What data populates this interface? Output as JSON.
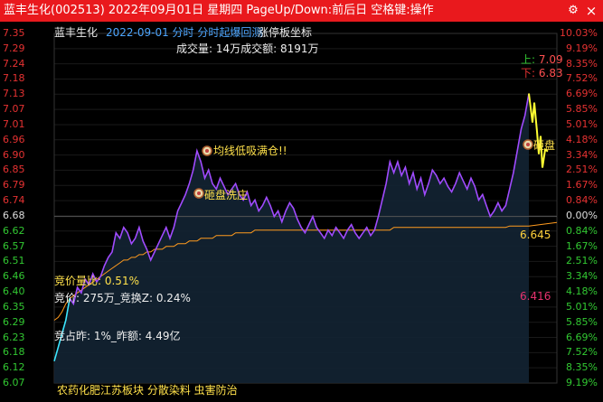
{
  "titlebar": {
    "title": "蓝丰生化(002513) 2022年09月01日 星期四 PageUp/Down:前后日 空格键:操作",
    "settings_icon": "gear-icon",
    "settings_glyph": "⚙",
    "close_icon": "close-icon",
    "close_glyph": "×"
  },
  "header": {
    "stock_name": "蓝丰生化",
    "info": "2022-09-01 分时 分时起爆回测",
    "mode": "涨停板坐标",
    "volume": "成交量: 14万成交额: 8191万"
  },
  "price_axis": [
    "7.35",
    "7.29",
    "7.24",
    "7.18",
    "7.13",
    "7.07",
    "7.01",
    "6.96",
    "6.90",
    "6.85",
    "6.79",
    "6.74",
    "6.68",
    "6.62",
    "6.57",
    "6.51",
    "6.46",
    "6.40",
    "6.35",
    "6.29",
    "6.23",
    "6.18",
    "6.12",
    "6.07"
  ],
  "pct_axis": [
    "10.03%",
    "9.19%",
    "8.35%",
    "7.52%",
    "6.69%",
    "5.85%",
    "5.01%",
    "4.18%",
    "3.34%",
    "2.51%",
    "1.67%",
    "0.84%",
    "0.00%",
    "0.84%",
    "1.67%",
    "2.51%",
    "3.34%",
    "4.18%",
    "5.01%",
    "5.85%",
    "6.69%",
    "7.52%",
    "8.35%",
    "9.19%"
  ],
  "markers": {
    "up_label": "上:",
    "up_value": "7.09",
    "down_label": "下:",
    "down_value": "6.83",
    "avg_price": "6.645",
    "low_price": "6.416"
  },
  "signals": {
    "s1": "均线低吸满仓!!",
    "s2": "砸盘洗庄",
    "s3": "砸盘"
  },
  "info_left": {
    "auction_ratio": "竞价量比: 0.51%",
    "auction_amount": "竞价: 275万_竞换Z: 0.24%",
    "auction_share": "竞占昨: 1%_昨额: 4.49亿"
  },
  "footer": {
    "sectors": "农药化肥江苏板块 分散染料 虫害防治"
  },
  "colors": {
    "titlebar": "#e9191d",
    "price_line": "#a04bff",
    "avg_line": "#ff9b1e",
    "open_line": "#3ce6ff",
    "end_line": "#ffff32",
    "up": "#e63232",
    "down": "#32c832"
  },
  "chart_data": {
    "type": "line",
    "ylim": [
      6.07,
      7.35
    ],
    "prev_close": 6.68,
    "series": [
      {
        "values": [
          6.15,
          6.2,
          6.25,
          6.3,
          6.38,
          6.36,
          6.42,
          6.4,
          6.45,
          6.43,
          6.47,
          6.44,
          6.46,
          6.5,
          6.53,
          6.55,
          6.62,
          6.6,
          6.64,
          6.62,
          6.58,
          6.6,
          6.64,
          6.59,
          6.56,
          6.52,
          6.55,
          6.58,
          6.61,
          6.64,
          6.6,
          6.64,
          6.7,
          6.73,
          6.76,
          6.8,
          6.85,
          6.92,
          6.88,
          6.82,
          6.85,
          6.8,
          6.78,
          6.82,
          6.79,
          6.76,
          6.78,
          6.8,
          6.76,
          6.74,
          6.77,
          6.72,
          6.74,
          6.7,
          6.72,
          6.75,
          6.72,
          6.68,
          6.7,
          6.66,
          6.7,
          6.73,
          6.71,
          6.67,
          6.64,
          6.62,
          6.65,
          6.68,
          6.64,
          6.62,
          6.6,
          6.63,
          6.61,
          6.64,
          6.62,
          6.6,
          6.63,
          6.65,
          6.62,
          6.6,
          6.62,
          6.64,
          6.61,
          6.63,
          6.68,
          6.74,
          6.8,
          6.88,
          6.84,
          6.88,
          6.83,
          6.86,
          6.8,
          6.84,
          6.78,
          6.82,
          6.76,
          6.8,
          6.85,
          6.83,
          6.8,
          6.82,
          6.79,
          6.77,
          6.8,
          6.84,
          6.81,
          6.78,
          6.82,
          6.79,
          6.74,
          6.76,
          6.72,
          6.68,
          6.7,
          6.73,
          6.7,
          6.72,
          6.78,
          6.84,
          6.92,
          7.0,
          7.05,
          7.13
        ]
      },
      {
        "values": [
          6.3,
          6.31,
          6.33,
          6.36,
          6.38,
          6.39,
          6.4,
          6.41,
          6.42,
          6.43,
          6.44,
          6.45,
          6.46,
          6.47,
          6.48,
          6.49,
          6.5,
          6.51,
          6.52,
          6.52,
          6.53,
          6.53,
          6.54,
          6.54,
          6.55,
          6.55,
          6.56,
          6.56,
          6.56,
          6.57,
          6.57,
          6.57,
          6.58,
          6.58,
          6.58,
          6.59,
          6.59,
          6.59,
          6.6,
          6.6,
          6.6,
          6.6,
          6.61,
          6.61,
          6.61,
          6.61,
          6.61,
          6.62,
          6.62,
          6.62,
          6.62,
          6.62,
          6.63,
          6.63,
          6.63,
          6.63,
          6.63,
          6.63,
          6.63,
          6.63,
          6.63,
          6.63,
          6.63,
          6.63,
          6.63,
          6.63,
          6.63,
          6.63,
          6.63,
          6.63,
          6.63,
          6.63,
          6.63,
          6.63,
          6.63,
          6.63,
          6.63,
          6.63,
          6.63,
          6.63,
          6.63,
          6.63,
          6.63,
          6.63,
          6.63,
          6.63,
          6.63,
          6.63,
          6.64,
          6.64,
          6.64,
          6.64,
          6.64,
          6.64,
          6.64,
          6.64,
          6.64,
          6.64,
          6.64,
          6.64,
          6.64,
          6.64,
          6.64,
          6.64,
          6.64,
          6.64,
          6.64,
          6.64,
          6.64,
          6.64,
          6.64,
          6.64,
          6.64,
          6.64,
          6.64,
          6.64,
          6.64,
          6.64,
          6.645,
          6.645,
          6.645,
          6.645,
          6.645,
          6.645
        ]
      }
    ]
  }
}
